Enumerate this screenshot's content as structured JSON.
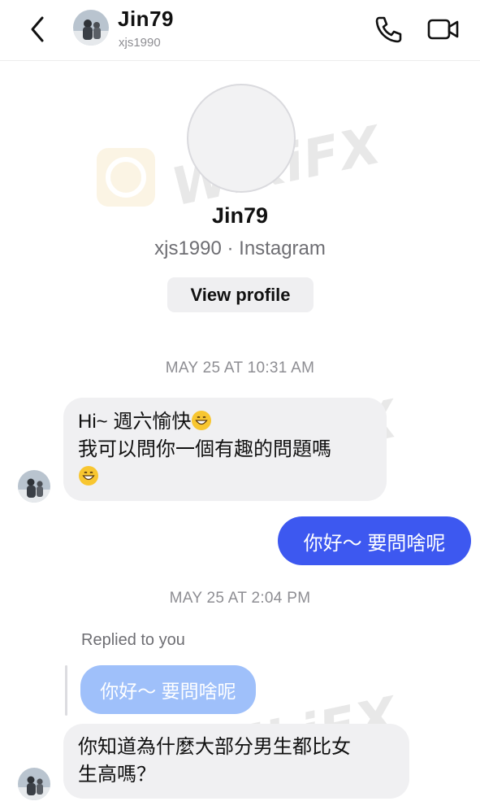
{
  "header": {
    "name": "Jin79",
    "username": "xjs1990",
    "back_icon": "chevron-left-icon",
    "call_icon": "phone-icon",
    "video_icon": "video-camera-icon"
  },
  "profile": {
    "name": "Jin79",
    "subtitle": "xjs1990 · Instagram",
    "view_profile_label": "View profile"
  },
  "watermark": {
    "text": "WikiFX"
  },
  "timestamps": [
    "MAY 25 AT 10:31 AM",
    "MAY 25 AT 2:04 PM"
  ],
  "messages": {
    "incoming_1": {
      "line1": "Hi~ 週六愉快",
      "line2": "我可以問你一個有趣的問題嗎"
    },
    "outgoing_1": "你好～ 要問啥呢",
    "reply_label": "Replied to you",
    "quoted": "你好～ 要問啥呢",
    "incoming_2": {
      "line1": "你知道為什麼大部分男生都比女",
      "line2": "生高嗎？"
    }
  },
  "colors": {
    "outgoing_bubble": "#3d58f0",
    "incoming_bubble": "#f0f0f2",
    "quoted_bubble": "#9fc0fa",
    "muted_text": "#8e8e93"
  }
}
